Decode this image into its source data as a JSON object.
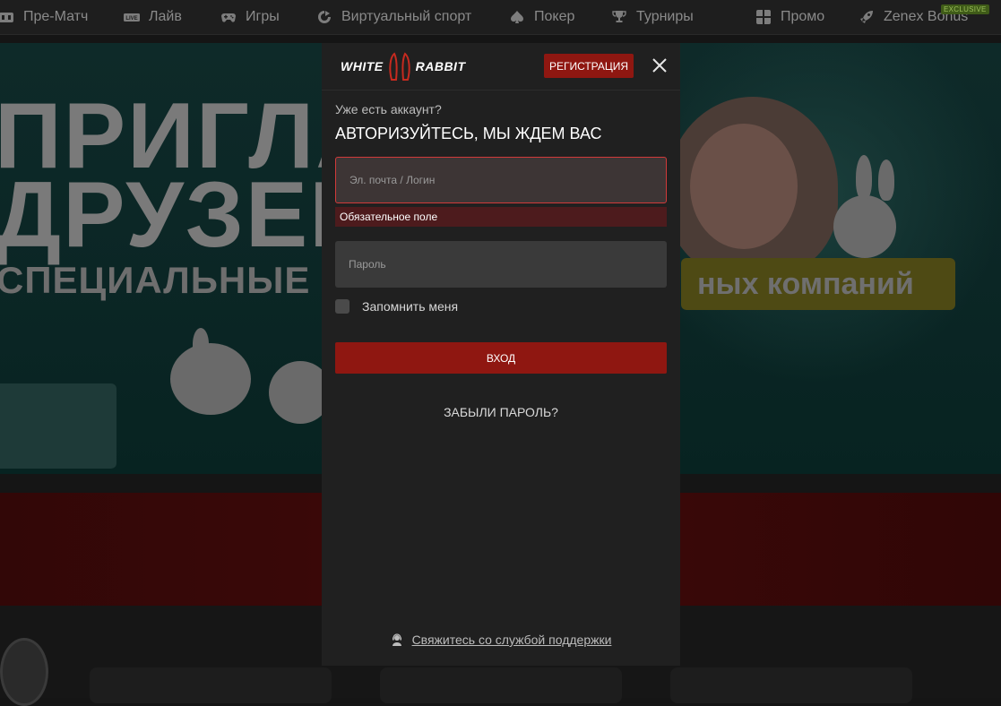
{
  "nav": {
    "items": [
      {
        "label": "Пре-Матч",
        "icon": "scoreboard-icon"
      },
      {
        "label": "Лайв",
        "icon": "live-icon"
      },
      {
        "label": "Игры",
        "icon": "gamepad-icon"
      },
      {
        "label": "Виртуальный спорт",
        "icon": "virtual-sport-icon"
      },
      {
        "label": "Покер",
        "icon": "poker-spade-icon"
      },
      {
        "label": "Турниры",
        "icon": "trophy-icon"
      },
      {
        "label": "Промо",
        "icon": "gift-icon"
      },
      {
        "label": "Zenex Bonus",
        "icon": "rocket-icon"
      }
    ],
    "exclusive_badge": "EXCLUSIVE",
    "live_tag": "LIVE"
  },
  "banner": {
    "line1": "ПРИГЛА",
    "line2": "ДРУЗЕЙ",
    "line3": "СПЕЦИАЛЬНЫЕ Б",
    "pill": "ных компаний"
  },
  "modal": {
    "logo_left": "WHITE",
    "logo_right": "RABBIT",
    "register_label": "РЕГИСТРАЦИЯ",
    "subtitle": "Уже есть аккаунт?",
    "title": "АВТОРИЗУЙТЕСЬ, МЫ ЖДЕМ ВАС",
    "login_placeholder": "Эл. почта / Логин",
    "login_error": "Обязательное поле",
    "password_placeholder": "Пароль",
    "remember_label": "Запомнить меня",
    "submit_label": "ВХОД",
    "forgot_label": "ЗАБЫЛИ ПАРОЛЬ?",
    "support_label": "Свяжитесь со службой поддержки"
  },
  "colors": {
    "accent_red": "#8f1711",
    "error_border": "#d23a3a",
    "error_bg": "#4d1b1d",
    "modal_bg": "#202020",
    "overlay_nav_text": "#8a8a8a"
  }
}
